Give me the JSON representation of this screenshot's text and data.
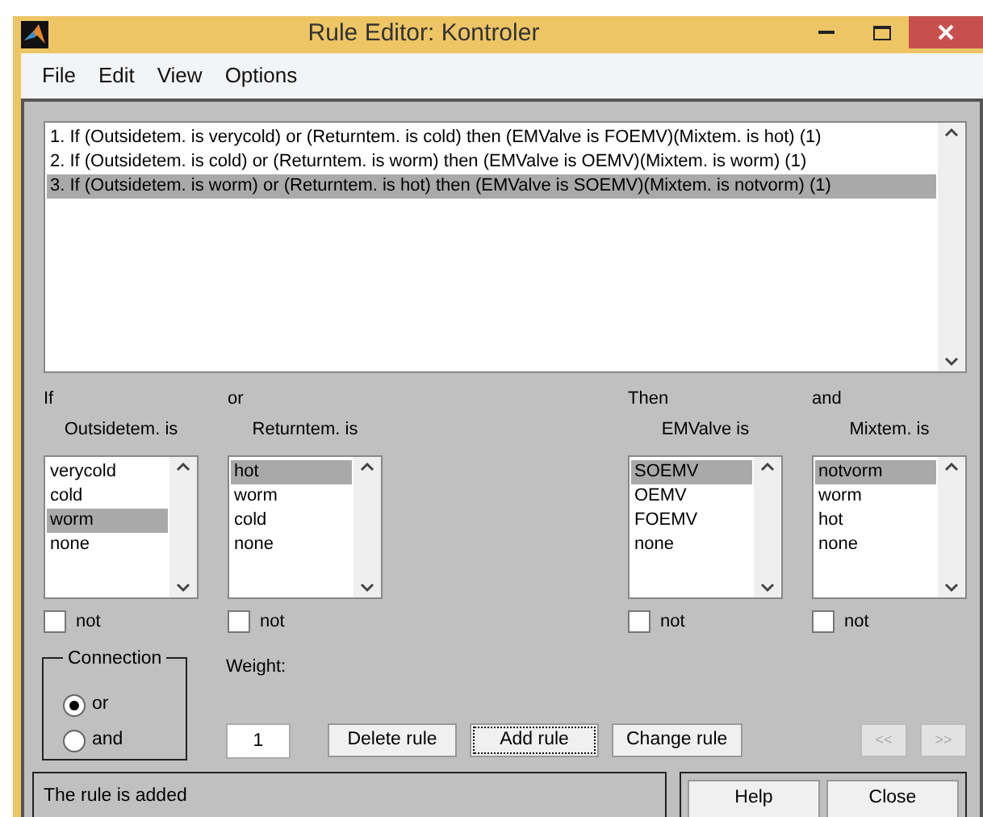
{
  "window": {
    "title": "Rule Editor: Kontroler"
  },
  "menu": [
    "File",
    "Edit",
    "View",
    "Options"
  ],
  "rules": [
    {
      "text": "1. If (Outsidetem. is verycold) or (Returntem. is cold) then (EMValve is FOEMV)(Mixtem. is hot) (1)",
      "selected": false
    },
    {
      "text": "2. If (Outsidetem. is cold) or (Returntem. is worm) then (EMValve is OEMV)(Mixtem. is worm) (1)",
      "selected": false
    },
    {
      "text": "3. If (Outsidetem. is worm) or (Returntem. is hot) then (EMValve is SOEMV)(Mixtem. is notvorm) (1)",
      "selected": true
    }
  ],
  "variables": [
    {
      "kind": "input",
      "connector": "If",
      "label": "Outsidetem. is",
      "options": [
        {
          "text": "verycold",
          "selected": false
        },
        {
          "text": "cold",
          "selected": false
        },
        {
          "text": "worm",
          "selected": true
        },
        {
          "text": "none",
          "selected": false
        }
      ],
      "not_label": "not",
      "not": false
    },
    {
      "kind": "input",
      "connector": "or",
      "label": "Returntem. is",
      "options": [
        {
          "text": "hot",
          "selected": true
        },
        {
          "text": "worm",
          "selected": false
        },
        {
          "text": "cold",
          "selected": false
        },
        {
          "text": "none",
          "selected": false
        }
      ],
      "not_label": "not",
      "not": false
    },
    {
      "kind": "output",
      "connector": "Then",
      "label": "EMValve is",
      "options": [
        {
          "text": "SOEMV",
          "selected": true
        },
        {
          "text": "OEMV",
          "selected": false
        },
        {
          "text": "FOEMV",
          "selected": false
        },
        {
          "text": "none",
          "selected": false
        }
      ],
      "not_label": "not",
      "not": false
    },
    {
      "kind": "output",
      "connector": "and",
      "label": "Mixtem. is",
      "options": [
        {
          "text": "notvorm",
          "selected": true
        },
        {
          "text": "worm",
          "selected": false
        },
        {
          "text": "hot",
          "selected": false
        },
        {
          "text": "none",
          "selected": false
        }
      ],
      "not_label": "not",
      "not": false
    }
  ],
  "connection": {
    "label": "Connection",
    "options": [
      {
        "label": "or",
        "selected": true
      },
      {
        "label": "and",
        "selected": false
      }
    ]
  },
  "weight": {
    "label": "Weight:",
    "value": "1"
  },
  "buttons": [
    {
      "label": "Delete rule",
      "kind": "action",
      "disabled": false,
      "focused": false
    },
    {
      "label": "Add rule",
      "kind": "action",
      "disabled": false,
      "focused": true
    },
    {
      "label": "Change rule",
      "kind": "action",
      "disabled": false,
      "focused": false
    },
    {
      "label": "<<",
      "kind": "nav",
      "disabled": true,
      "focused": false
    },
    {
      "label": ">>",
      "kind": "nav",
      "disabled": true,
      "focused": false
    }
  ],
  "status": "The rule is added",
  "footer_buttons": [
    "Help",
    "Close"
  ]
}
